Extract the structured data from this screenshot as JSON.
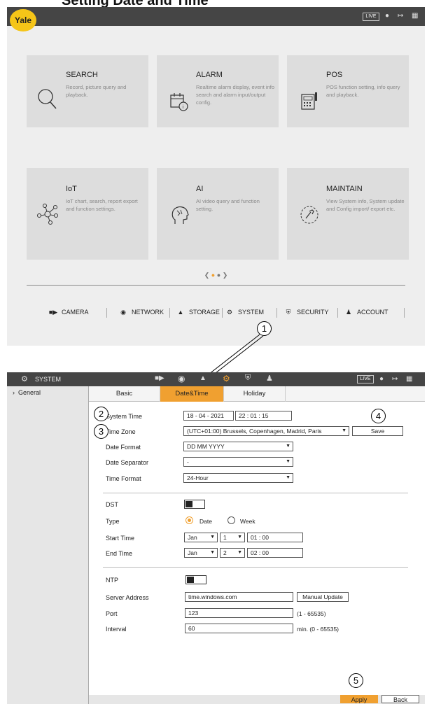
{
  "doc_title": "Setting Date and Time",
  "screen1": {
    "logo": "Yale",
    "topbar": {
      "live_label": "LIVE",
      "icons": [
        "user-icon",
        "logout-icon",
        "grid-icon"
      ]
    },
    "tiles": [
      {
        "title": "SEARCH",
        "desc": "Record, picture query and playback.",
        "icon": "search-icon"
      },
      {
        "title": "ALARM",
        "desc": "Realtime alarm display, event info search and alarm input/output config.",
        "icon": "alarm-calendar-icon"
      },
      {
        "title": "POS",
        "desc": "POS function setting, info query and playback.",
        "icon": "pos-icon"
      },
      {
        "title": "IoT",
        "desc": "IoT chart, search, report export and function settings.",
        "icon": "iot-icon"
      },
      {
        "title": "AI",
        "desc": "AI video query and function setting.",
        "icon": "ai-head-icon"
      },
      {
        "title": "MAINTAIN",
        "desc": "View System info, System update and Config import/ export etc.",
        "icon": "maintain-icon"
      }
    ],
    "menu": [
      {
        "label": "CAMERA",
        "icon": "camera-icon"
      },
      {
        "label": "NETWORK",
        "icon": "network-icon"
      },
      {
        "label": "STORAGE",
        "icon": "storage-icon"
      },
      {
        "label": "SYSTEM",
        "icon": "gears-icon"
      },
      {
        "label": "SECURITY",
        "icon": "shield-icon"
      },
      {
        "label": "ACCOUNT",
        "icon": "account-icon"
      }
    ]
  },
  "callouts": [
    "1",
    "2",
    "3",
    "4",
    "5"
  ],
  "screen2": {
    "section_title": "SYSTEM",
    "live_label": "LIVE",
    "sidebar_item": "General",
    "tabs": [
      {
        "label": "Basic",
        "active": false
      },
      {
        "label": "Date&Time",
        "active": true
      },
      {
        "label": "Holiday",
        "active": false
      }
    ],
    "labels": {
      "system_time": "System Time",
      "time_zone": "Time Zone",
      "date_format": "Date Format",
      "date_separator": "Date Separator",
      "time_format": "Time Format",
      "dst": "DST",
      "type": "Type",
      "start_time": "Start Time",
      "end_time": "End Time",
      "ntp": "NTP",
      "server_address": "Server Address",
      "port": "Port",
      "interval": "Interval"
    },
    "values": {
      "date": "18 - 04 - 2021",
      "time": "22 : 01 : 15",
      "time_zone": "(UTC+01:00) Brussels, Copenhagen, Madrid, Paris",
      "date_format": "DD MM YYYY",
      "date_separator": "-",
      "time_format": "24-Hour",
      "type_date": "Date",
      "type_week": "Week",
      "start_month": "Jan",
      "start_day": "1",
      "start_time": "01 : 00",
      "end_month": "Jan",
      "end_day": "2",
      "end_time": "02 : 00",
      "server": "time.windows.com",
      "port": "123",
      "port_range": "(1 - 65535)",
      "interval": "60",
      "interval_range": "min.  (0 - 65535)"
    },
    "buttons": {
      "save": "Save",
      "manual_update": "Manual Update",
      "apply": "Apply",
      "back": "Back"
    },
    "colors": {
      "accent": "#f0a030",
      "topbar": "#454545"
    }
  }
}
